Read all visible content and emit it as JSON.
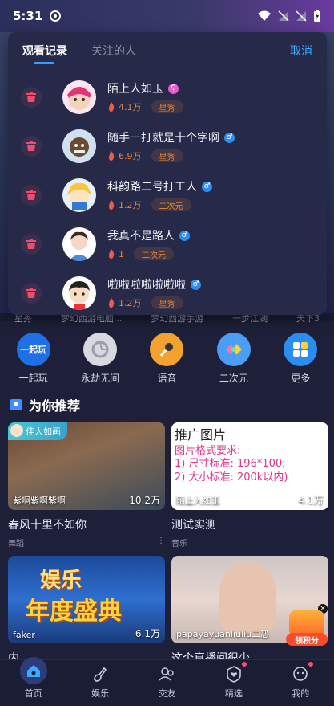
{
  "status_bar": {
    "time": "5:31"
  },
  "popup": {
    "tabs": [
      {
        "label": "观看记录",
        "active": true
      },
      {
        "label": "关注的人",
        "active": false
      }
    ],
    "cancel_label": "取消",
    "history": [
      {
        "name": "陌上人如玉",
        "gender": "female",
        "heat": "4.1万",
        "level": "星秀"
      },
      {
        "name": "随手一打就是十个字啊",
        "gender": "male",
        "heat": "6.9万",
        "level": "星秀"
      },
      {
        "name": "科韵路二号打工人",
        "gender": "male",
        "heat": "1.2万",
        "level": "二次元"
      },
      {
        "name": "我真不是路人",
        "gender": "male",
        "heat": "1",
        "level": "二次元"
      },
      {
        "name": "啦啦啦啦啦啦啦",
        "gender": "male",
        "heat": "1.2万",
        "level": "星秀"
      }
    ]
  },
  "partial_labels": [
    "星秀",
    "梦幻西游电脑...",
    "梦幻西游手游",
    "一步江湖",
    "天下3"
  ],
  "quick_grid": [
    {
      "label": "一起玩",
      "icon": "play-together-icon",
      "badge": "一起玩"
    },
    {
      "label": "永劫无间",
      "icon": "naraka-icon"
    },
    {
      "label": "语音",
      "icon": "microphone-icon"
    },
    {
      "label": "二次元",
      "icon": "anime-icon"
    },
    {
      "label": "更多",
      "icon": "more-grid-icon"
    }
  ],
  "recommend": {
    "title": "为你推荐",
    "cards": [
      {
        "anchor": "紫啊紫啊紫啊",
        "views": "10.2万",
        "title": "春风十里不如你",
        "tag": "舞蹈",
        "badge": "佳人如画"
      },
      {
        "anchor": "陌上人如玉",
        "views": "4.1万",
        "title": "测试实测",
        "tag": "音乐",
        "ad_head": "推广图片",
        "ad_lines": [
          "图片格式要求:",
          "1) 尺寸标准: 196*100;",
          "2) 大小标准: 200k以内)"
        ]
      },
      {
        "anchor": "faker",
        "views": "6.1万",
        "title": "内",
        "poster": "娱乐",
        "poster2": "年度盛典"
      },
      {
        "anchor": "papayayuanliuliu二恶",
        "views": "",
        "title": "这个直播间很少"
      }
    ]
  },
  "gift_float_label": "领积分",
  "bottom_nav": [
    {
      "label": "首页",
      "icon": "home-icon",
      "active": true,
      "dot": false
    },
    {
      "label": "娱乐",
      "icon": "music-note-icon",
      "active": false,
      "dot": false
    },
    {
      "label": "交友",
      "icon": "friends-icon",
      "active": false,
      "dot": false
    },
    {
      "label": "精选",
      "icon": "heart-shield-icon",
      "active": false,
      "dot": true
    },
    {
      "label": "我的",
      "icon": "profile-icon",
      "active": false,
      "dot": true
    }
  ],
  "colors": {
    "accent_blue": "#3a9cff",
    "level_orange": "#e9883a",
    "male_blue": "#2f8cf0",
    "female_pink": "#e55ad0"
  }
}
